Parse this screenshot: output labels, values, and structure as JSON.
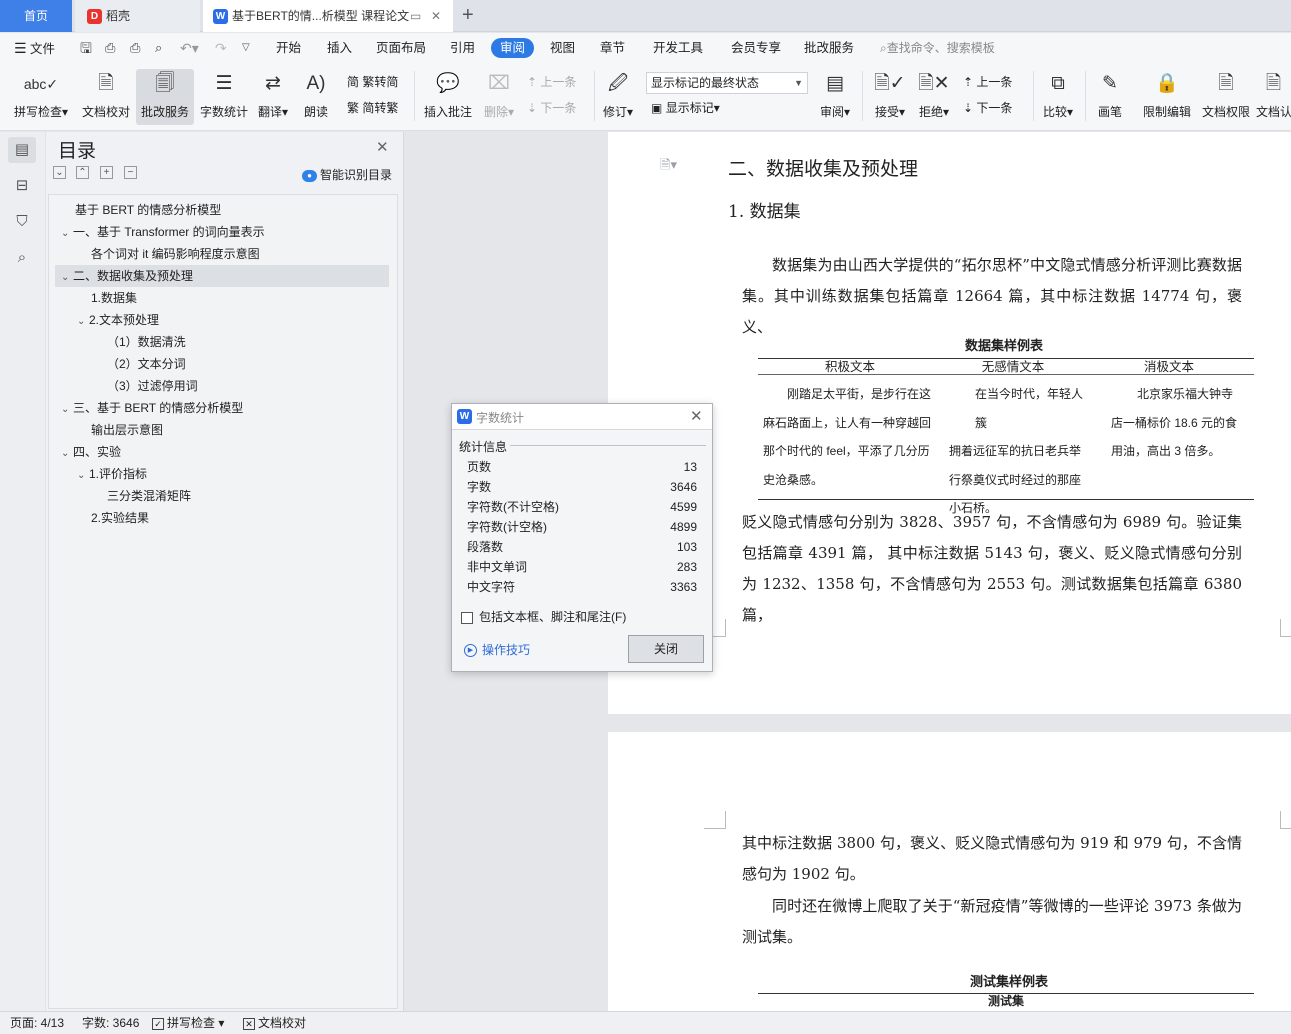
{
  "tabs": {
    "home": "首页",
    "daoke": "稻壳",
    "doc": "基于BERT的情...析模型 课程论文",
    "new_tab": "+"
  },
  "menu": {
    "file": "文件",
    "items": [
      "开始",
      "插入",
      "页面布局",
      "引用",
      "审阅",
      "视图",
      "章节",
      "开发工具",
      "会员专享",
      "批改服务"
    ],
    "search": "查找命令、搜索模板"
  },
  "ribbon": {
    "spell_check": "拼写检查",
    "doc_proof": "文档校对",
    "correct_service": "批改服务",
    "word_count": "字数统计",
    "translate": "翻译",
    "read_aloud": "朗读",
    "to_simplified": "繁转简",
    "to_traditional": "简转繁",
    "insert_comment": "插入批注",
    "delete": "删除",
    "prev": "上一条",
    "next": "下一条",
    "track_changes": "修订",
    "markup_state": "显示标记的最终状态",
    "show_markup": "显示标记",
    "review_pane": "审阅",
    "accept": "接受",
    "reject": "拒绝",
    "prev2": "上一条",
    "next2": "下一条",
    "compare": "比较",
    "pen": "画笔",
    "restrict_edit": "限制编辑",
    "doc_permission": "文档权限",
    "doc_cert": "文档认"
  },
  "toc": {
    "title": "目录",
    "smart": "智能识别目录",
    "items": [
      {
        "label": "基于 BERT 的情感分析模型",
        "arrow": ""
      },
      {
        "label": "一、基于 Transformer 的词向量表示",
        "arrow": "⌄"
      },
      {
        "label": "各个词对 it 编码影响程度示意图",
        "arrow": ""
      },
      {
        "label": "二、数据收集及预处理",
        "arrow": "⌄"
      },
      {
        "label": "1.数据集",
        "arrow": ""
      },
      {
        "label": "2.文本预处理",
        "arrow": "⌄"
      },
      {
        "label": "（1）数据清洗",
        "arrow": ""
      },
      {
        "label": "（2）文本分词",
        "arrow": ""
      },
      {
        "label": "（3）过滤停用词",
        "arrow": ""
      },
      {
        "label": "三、基于 BERT 的情感分析模型",
        "arrow": "⌄"
      },
      {
        "label": "输出层示意图",
        "arrow": ""
      },
      {
        "label": "四、实验",
        "arrow": "⌄"
      },
      {
        "label": "1.评价指标",
        "arrow": "⌄"
      },
      {
        "label": "三分类混淆矩阵",
        "arrow": ""
      },
      {
        "label": "2.实验结果",
        "arrow": ""
      }
    ]
  },
  "document": {
    "h2": "二、数据收集及预处理",
    "h3": "1. 数据集",
    "para1": "数据集为由山西大学提供的“拓尔思杯”中文隐式情感分析评测比赛数据集。其中训练数据集包括篇章 12664 篇，其中标注数据 14774 句，褒义、",
    "table1": {
      "caption": "数据集样例表",
      "headers": [
        "积极文本",
        "无感情文本",
        "消极文本"
      ],
      "col1": [
        "刚踏足太平街，是步行在这",
        "麻石路面上，让人有一种穿越回",
        "那个时代的 feel，平添了几分历",
        "史沧桑感。"
      ],
      "col2": [
        "在当今时代，年轻人簇",
        "拥着远征军的抗日老兵举",
        "行祭奠仪式时经过的那座",
        "小石桥。"
      ],
      "col3": [
        "北京家乐福大钟寺",
        "店一桶标价 18.6 元的食",
        "用油，高出 3 倍多。"
      ]
    },
    "para2": "贬义隐式情感句分别为 3828、3957 句，不含情感句为 6989 句。验证集包括篇章 4391 篇， 其中标注数据 5143 句，褒义、贬义隐式情感句分别为 1232、1358 句，不含情感句为 2553 句。测试数据集包括篇章 6380 篇，",
    "para3": "其中标注数据 3800 句，褒义、贬义隐式情感句为 919 和 979 句，不含情感句为 1902 句。",
    "para4": "同时还在微博上爬取了关于“新冠疫情”等微博的一些评论 3973 条做为测试集。",
    "table2": {
      "caption": "测试集样例表",
      "header": "测试集"
    }
  },
  "dialog": {
    "title": "字数统计",
    "group": "统计信息",
    "rows": [
      {
        "label": "页数",
        "value": "13"
      },
      {
        "label": "字数",
        "value": "3646"
      },
      {
        "label": "字符数(不计空格)",
        "value": "4599"
      },
      {
        "label": "字符数(计空格)",
        "value": "4899"
      },
      {
        "label": "段落数",
        "value": "103"
      },
      {
        "label": "非中文单词",
        "value": "283"
      },
      {
        "label": "中文字符",
        "value": "3363"
      }
    ],
    "checkbox": "包括文本框、脚注和尾注(F)",
    "tips": "操作技巧",
    "close": "关闭"
  },
  "status": {
    "page": "页面: 4/13",
    "words": "字数: 3646",
    "spell": "拼写检查",
    "proof": "文档校对"
  },
  "colors": {
    "accent": "#2d7ae5",
    "home_tab": "#3f7fe8",
    "link": "#2f6bd9"
  }
}
